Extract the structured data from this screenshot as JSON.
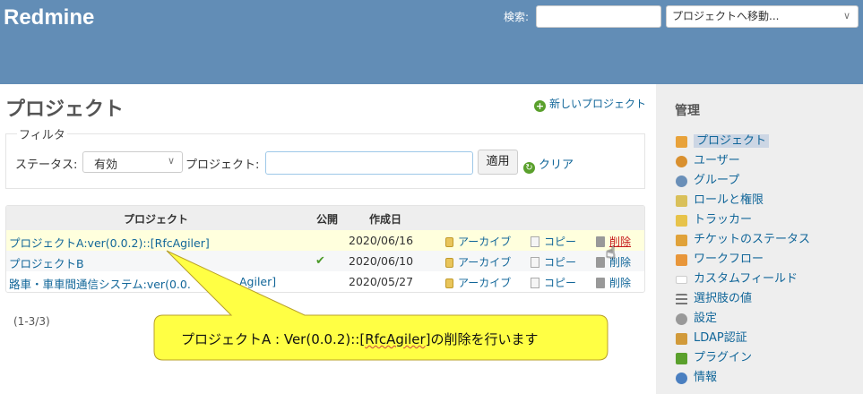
{
  "header": {
    "logo": "Redmine",
    "search_label": "検索:",
    "jump_placeholder": "プロジェクトへ移動..."
  },
  "main": {
    "title": "プロジェクト",
    "new_project": "新しいプロジェクト",
    "filter": {
      "legend": "フィルタ",
      "status_label": "ステータス:",
      "status_value": "有効",
      "project_label": "プロジェクト:",
      "project_value": "",
      "apply": "適用",
      "clear": "クリア"
    },
    "table": {
      "headers": {
        "project": "プロジェクト",
        "public": "公開",
        "created": "作成日"
      },
      "rows": [
        {
          "name": "プロジェクトA:ver(0.0.2)::[RfcAgiler]",
          "public": "",
          "created": "2020/06/16",
          "archive": "アーカイブ",
          "copy": "コピー",
          "delete": "削除"
        },
        {
          "name": "プロジェクトB",
          "public": "✔",
          "created": "2020/06/10",
          "archive": "アーカイブ",
          "copy": "コピー",
          "delete": "削除"
        },
        {
          "name": "路車・車車間通信システム:ver(0.0.",
          "name_tail": "Agiler]",
          "public": "",
          "created": "2020/05/27",
          "archive": "アーカイブ",
          "copy": "コピー",
          "delete": "削除"
        }
      ]
    },
    "pagination": "(1-3/3)"
  },
  "callout": {
    "prefix": "プロジェクトA : Ver(0.0.2)::[",
    "underlined": "RfcAgiler",
    "suffix": "]の削除を行います",
    "fill": "#ffff44"
  },
  "sidebar": {
    "title": "管理",
    "items": [
      {
        "label": "プロジェクト",
        "icon": "projects-icon",
        "color": "#e8a23a"
      },
      {
        "label": "ユーザー",
        "icon": "user-icon",
        "color": "#d9902f"
      },
      {
        "label": "グループ",
        "icon": "group-icon",
        "color": "#6a8fb8"
      },
      {
        "label": "ロールと権限",
        "icon": "key-icon",
        "color": "#d9c05a"
      },
      {
        "label": "トラッカー",
        "icon": "tracker-icon",
        "color": "#e7c34a"
      },
      {
        "label": "チケットのステータス",
        "icon": "status-icon",
        "color": "#e0a23a"
      },
      {
        "label": "ワークフロー",
        "icon": "workflow-icon",
        "color": "#e8963a"
      },
      {
        "label": "カスタムフィールド",
        "icon": "custom-field-icon",
        "color": "#ffffff"
      },
      {
        "label": "選択肢の値",
        "icon": "list-icon",
        "color": "#777777"
      },
      {
        "label": "設定",
        "icon": "gear-icon",
        "color": "#999999"
      },
      {
        "label": "LDAP認証",
        "icon": "server-icon",
        "color": "#d19a3a"
      },
      {
        "label": "プラグイン",
        "icon": "plugin-icon",
        "color": "#5aa02c"
      },
      {
        "label": "情報",
        "icon": "help-icon",
        "color": "#4a7fc0"
      }
    ]
  }
}
